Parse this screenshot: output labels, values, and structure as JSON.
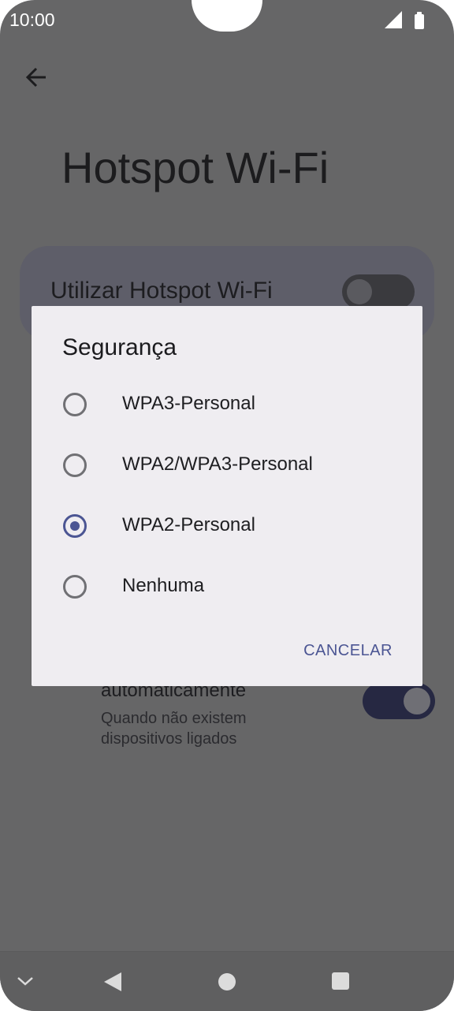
{
  "status_bar": {
    "time": "10:00",
    "signal_icon": "signal-icon",
    "battery_icon": "battery-icon"
  },
  "header": {
    "back_icon": "back-arrow-icon",
    "title": "Hotspot Wi-Fi"
  },
  "background_settings": {
    "hotspot_toggle_label": "Utilizar Hotspot Wi-Fi",
    "hotspot_toggle_on": false,
    "auto_off_title": "automaticamente",
    "auto_off_subtitle": "Quando não existem dispositivos ligados",
    "auto_off_toggle_on": true
  },
  "dialog": {
    "title": "Segurança",
    "options": [
      {
        "label": "WPA3-Personal",
        "selected": false
      },
      {
        "label": "WPA2/WPA3-Personal",
        "selected": false
      },
      {
        "label": "WPA2-Personal",
        "selected": true
      },
      {
        "label": "Nenhuma",
        "selected": false
      }
    ],
    "cancel_label": "CANCELAR"
  },
  "nav_bar": {
    "icons": [
      "chevron-down-icon",
      "back-triangle-icon",
      "home-circle-icon",
      "recents-square-icon"
    ]
  },
  "colors": {
    "accent": "#4b5593",
    "scrim": "#666667",
    "dialog_bg": "#efedf1"
  }
}
